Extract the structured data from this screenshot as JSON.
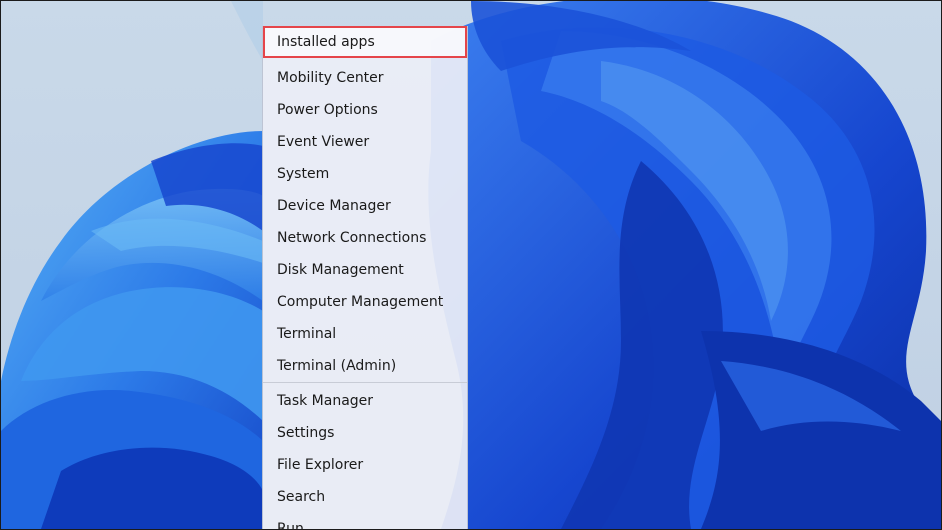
{
  "context_menu": {
    "items": [
      {
        "label": "Installed apps",
        "highlighted": true
      },
      {
        "label": "Mobility Center"
      },
      {
        "label": "Power Options"
      },
      {
        "label": "Event Viewer"
      },
      {
        "label": "System"
      },
      {
        "label": "Device Manager"
      },
      {
        "label": "Network Connections"
      },
      {
        "label": "Disk Management"
      },
      {
        "label": "Computer Management"
      },
      {
        "label": "Terminal"
      },
      {
        "label": "Terminal (Admin)"
      },
      {
        "label": "Task Manager"
      },
      {
        "label": "Settings"
      },
      {
        "label": "File Explorer"
      },
      {
        "label": "Search"
      },
      {
        "label": "Run"
      }
    ],
    "highlight_color": "#e5454a"
  },
  "wallpaper": {
    "name": "windows-11-bloom",
    "colors": {
      "sky": "#c7d8e8",
      "bloom_dark": "#0a2fb0",
      "bloom_mid": "#1f5fe0",
      "bloom_light": "#49a6f2"
    }
  }
}
